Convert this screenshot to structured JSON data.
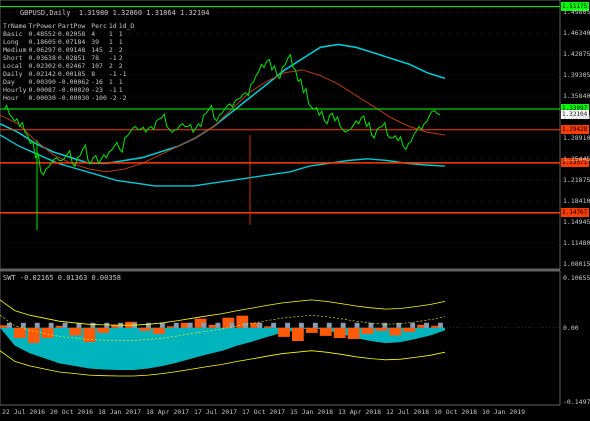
{
  "header": {
    "symbol_line": "GBPUSD,Daily",
    "ohlc": "1.31980 1.32860 1.31864 1.32104"
  },
  "table": {
    "columns": [
      "TrName",
      "TrPower",
      "PartPow",
      "Perc",
      "1d",
      "1d_D"
    ],
    "rows": [
      [
        "Basic",
        "0.48552",
        "0.02058",
        "4",
        "1",
        "1"
      ],
      [
        "Long",
        "0.18605",
        "0.07184",
        "39",
        "1",
        "1"
      ],
      [
        "Medium",
        "0.06297",
        "0.09148",
        "145",
        "2",
        "2"
      ],
      [
        "Short",
        "0.03638",
        "0.02851",
        "78",
        "-1",
        "2"
      ],
      [
        "Local",
        "0.02302",
        "0.02467",
        "107",
        "2",
        "2"
      ],
      [
        "Daily",
        "0.02142",
        "0.00185",
        "8",
        "-1",
        "-1"
      ],
      [
        "Day",
        "0.00390",
        "-0.00062",
        "-16",
        "1",
        "1"
      ],
      [
        "Hourly",
        "0.00087",
        "-0.00020",
        "-23",
        "-1",
        "1"
      ],
      [
        "Hour",
        "0.00030",
        "-0.00030",
        "-100",
        "-2",
        "-2"
      ]
    ]
  },
  "subwindow": {
    "label": "SWT -0.02165 0.01363 0.00358"
  },
  "colors": {
    "price": "#00e600",
    "cyan": "#00c8d2",
    "orange": "#ff5a0a",
    "red_line": "#ff3c00",
    "brown": "#b43c14",
    "yellow": "#ffff00",
    "steel": "#8c9bb4",
    "sky": "#7ab4d2",
    "green_box": "#00ff00",
    "grid_dot": "#3c3c3c"
  },
  "chart_data": [
    {
      "type": "line",
      "title": "GBPUSD,Daily",
      "ylim": [
        1.05,
        1.52
      ],
      "yticks": [
        "1.49805",
        "1.46340",
        "1.42875",
        "1.39305",
        "1.35840",
        "1.32104",
        "1.28910",
        "1.25445",
        "1.21875",
        "1.18410",
        "1.14945",
        "1.11480",
        "1.08015"
      ],
      "xticks": [
        "22 Jul 2016",
        "20 Oct 2016",
        "18 Jan 2017",
        "18 Apr 2017",
        "17 Jul 2017",
        "17 Oct 2017",
        "15 Jan 2018",
        "13 Apr 2018",
        "12 Jul 2018",
        "10 Oct 2018",
        "10 Jan 2019"
      ],
      "price_labels": [
        {
          "value": "1.51175",
          "bg": "#00ff00",
          "fg": "#000000"
        },
        {
          "value": "1.33097",
          "bg": "#00ff00",
          "fg": "#000000"
        },
        {
          "value": "1.32104",
          "bg": "#ffffff",
          "fg": "#000000"
        },
        {
          "value": "1.29428",
          "bg": "#ff3c00",
          "fg": "#000000"
        },
        {
          "value": "1.23571",
          "bg": "#ff3c00",
          "fg": "#000000"
        },
        {
          "value": "1.14767",
          "bg": "#ff3c00",
          "fg": "#000000"
        }
      ],
      "series": [
        {
          "name": "",
          "role": "price",
          "values": [
            1.33,
            1.322,
            1.31,
            1.3,
            1.29,
            1.27,
            1.245,
            1.22,
            1.225,
            1.235,
            1.245,
            1.24,
            1.25,
            1.235,
            1.245,
            1.26,
            1.24,
            1.245,
            1.235,
            1.25,
            1.255,
            1.265,
            1.26,
            1.28,
            1.29,
            1.3,
            1.295,
            1.29,
            1.3,
            1.31,
            1.315,
            1.3,
            1.29,
            1.295,
            1.305,
            1.3,
            1.29,
            1.305,
            1.32,
            1.33,
            1.315,
            1.32,
            1.33,
            1.34,
            1.345,
            1.35,
            1.36,
            1.375,
            1.39,
            1.41,
            1.415,
            1.4,
            1.39,
            1.405,
            1.42,
            1.405,
            1.38,
            1.36,
            1.34,
            1.33,
            1.32,
            1.31,
            1.32,
            1.31,
            1.3,
            1.29,
            1.295,
            1.31,
            1.315,
            1.3,
            1.285,
            1.295,
            1.3,
            1.285,
            1.28,
            1.275,
            1.265,
            1.27,
            1.285,
            1.3,
            1.305,
            1.32,
            1.328,
            1.321
          ]
        },
        {
          "name": "",
          "role": "cyan_ma",
          "values": [
            1.305,
            1.29,
            1.27,
            1.255,
            1.245,
            1.235,
            1.235,
            1.24,
            1.245,
            1.255,
            1.265,
            1.28,
            1.3,
            1.325,
            1.35,
            1.375,
            1.4,
            1.42,
            1.44,
            1.445,
            1.44,
            1.43,
            1.42,
            1.41,
            1.395,
            1.385
          ]
        },
        {
          "name": "",
          "role": "cyan_ma2",
          "values": [
            1.285,
            1.265,
            1.25,
            1.235,
            1.225,
            1.215,
            1.205,
            1.2,
            1.195,
            1.195,
            1.195,
            1.2,
            1.205,
            1.21,
            1.215,
            1.22,
            1.23,
            1.235,
            1.24,
            1.243,
            1.24,
            1.235,
            1.232,
            1.23
          ]
        },
        {
          "name": "",
          "role": "brown_ma",
          "values": [
            1.32,
            1.305,
            1.275,
            1.25,
            1.235,
            1.225,
            1.22,
            1.225,
            1.235,
            1.25,
            1.265,
            1.28,
            1.3,
            1.33,
            1.36,
            1.38,
            1.395,
            1.4,
            1.39,
            1.375,
            1.355,
            1.335,
            1.315,
            1.3,
            1.29,
            1.285
          ]
        }
      ],
      "levels": [
        1.51175,
        1.33097,
        1.29428,
        1.23571,
        1.14767
      ]
    },
    {
      "type": "area",
      "title": "SWT",
      "ylim": [
        -0.15,
        0.11
      ],
      "yticks": [
        "0.10655",
        "0.00",
        "-0.14978"
      ],
      "series": [
        {
          "name": "",
          "role": "cyan_area",
          "values": [
            0.0,
            -0.035,
            -0.05,
            -0.06,
            -0.07,
            -0.075,
            -0.08,
            -0.082,
            -0.083,
            -0.083,
            -0.08,
            -0.075,
            -0.068,
            -0.06,
            -0.052,
            -0.045,
            -0.035,
            -0.027,
            -0.018,
            -0.01,
            -0.005,
            0.0,
            -0.005,
            -0.012,
            -0.02,
            -0.026,
            -0.03,
            -0.028,
            -0.022,
            -0.015,
            -0.005
          ]
        },
        {
          "name": "",
          "role": "orange_bars",
          "values": [
            0.005,
            -0.02,
            -0.03,
            -0.02,
            0.004,
            -0.015,
            -0.028,
            -0.01,
            0.006,
            0.012,
            -0.006,
            -0.012,
            0.003,
            0.01,
            0.018,
            0.006,
            0.02,
            0.024,
            0.01,
            0.003,
            -0.018,
            -0.026,
            -0.01,
            -0.016,
            -0.02,
            -0.022,
            -0.012,
            -0.006,
            -0.015,
            -0.008,
            0.006,
            0.004
          ]
        }
      ]
    }
  ]
}
